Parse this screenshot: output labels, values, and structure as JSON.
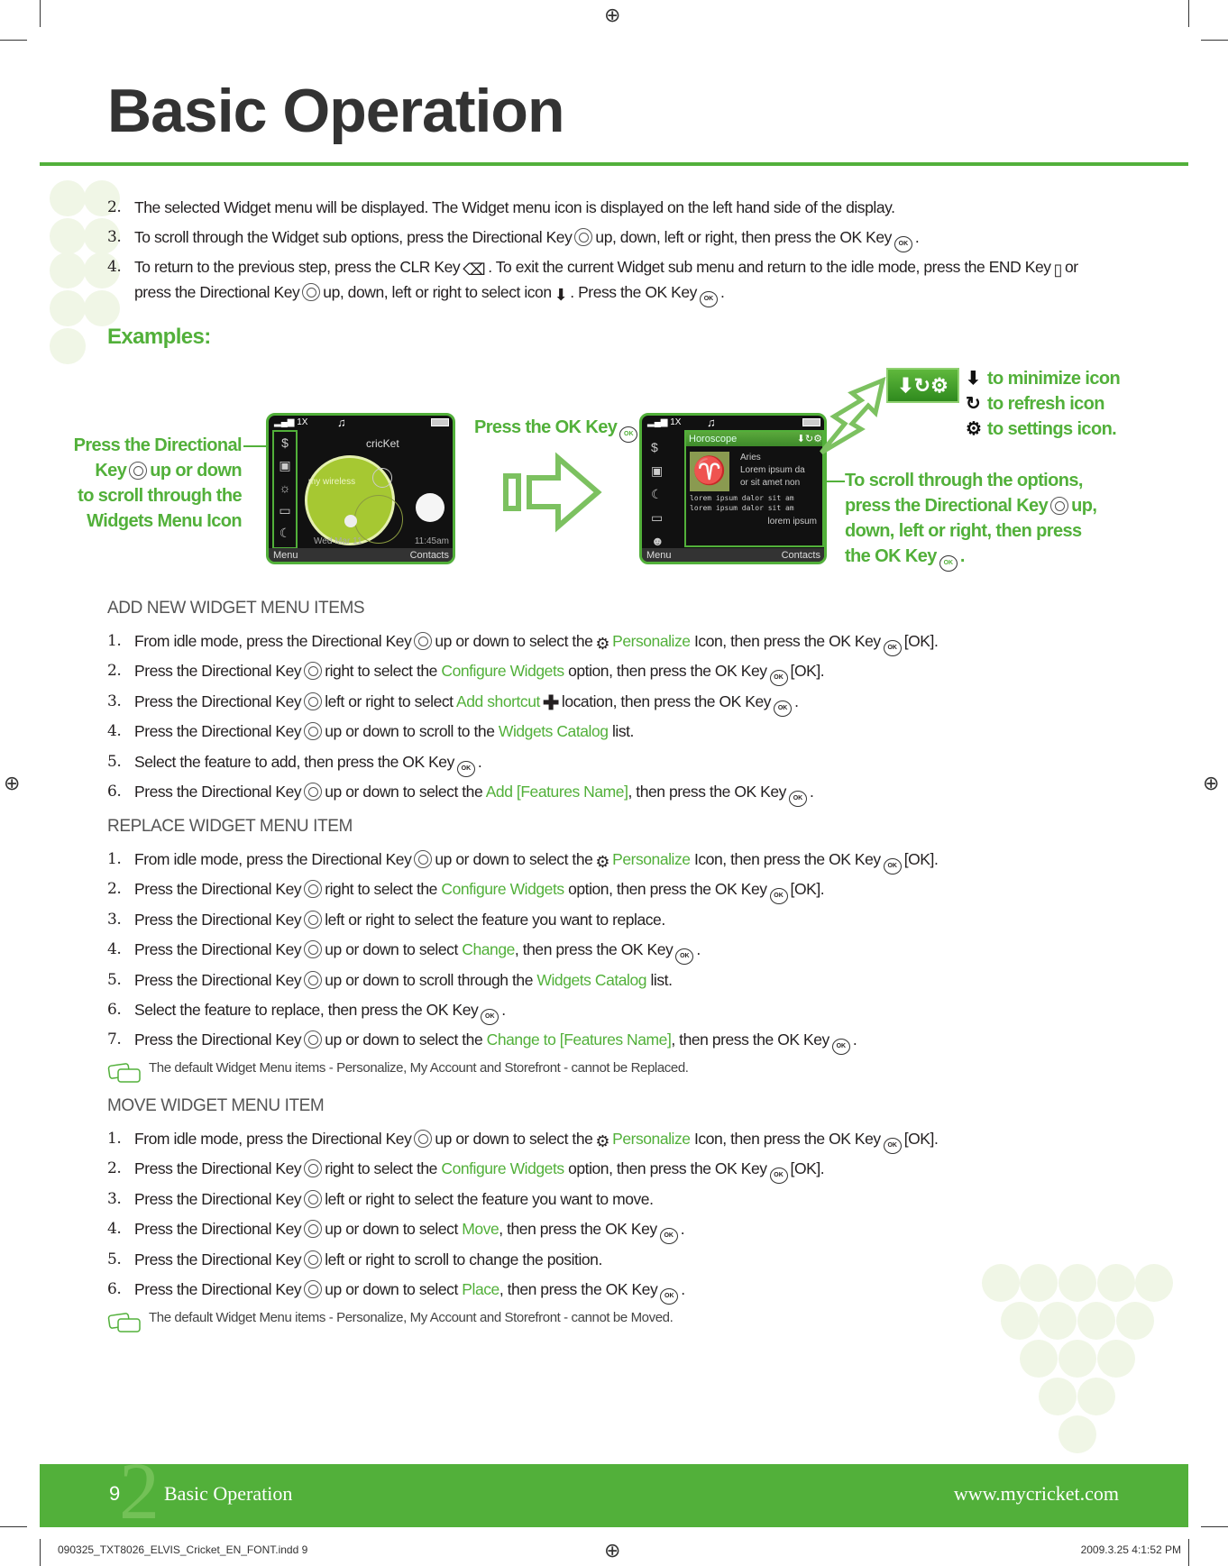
{
  "page_title": "Basic Operation",
  "colors": {
    "accent": "#52b03a",
    "heading": "#555555"
  },
  "intro_steps": [
    {
      "num": "2.",
      "segs": [
        {
          "t": "The selected Widget menu will be displayed. The Widget menu icon is displayed on the left hand side of the display."
        }
      ]
    },
    {
      "num": "3.",
      "segs": [
        {
          "t": "To scroll through the Widget sub options, press the Directional Key"
        },
        {
          "k": "dkey"
        },
        {
          "t": "up, down, left or right, then press the OK Key"
        },
        {
          "k": "ok"
        },
        {
          "t": "."
        }
      ]
    },
    {
      "num": "4.",
      "segs": [
        {
          "t": "To return to the previous step, press the CLR Key"
        },
        {
          "k": "clr"
        },
        {
          "t": ". To exit the current Widget sub menu and return to the idle mode, press the END Key"
        },
        {
          "k": "end"
        },
        {
          "t": "or press the Directional Key"
        },
        {
          "k": "dkey"
        },
        {
          "t": "up, down, left or right to select icon"
        },
        {
          "k": "down-arrow"
        },
        {
          "t": ". Press the OK Key"
        },
        {
          "k": "ok"
        },
        {
          "t": "."
        }
      ]
    }
  ],
  "examples_label": "Examples:",
  "diagram": {
    "left_caption": [
      "Press the Directional",
      "Key",
      "up or down",
      "to scroll through the",
      "Widgets Menu Icon"
    ],
    "ok_caption": "Press the OK Key",
    "right_caption": [
      "To scroll through the options,",
      "press the Directional Key",
      "up,",
      "down, left or right, then press",
      "the OK Key"
    ],
    "legend": [
      "to minimize icon",
      "to refresh icon",
      "to settings icon."
    ],
    "phone1": {
      "brand": "cricKet",
      "bubble": "my wireless",
      "date": "Wed Mar 11",
      "time": "11:45am",
      "soft_left": "Menu",
      "soft_right": "Contacts",
      "network": "1X"
    },
    "phone2": {
      "widget_title": "Horoscope",
      "sign": "Aries",
      "text1": "Lorem ipsum da",
      "text2": "or sit amet non",
      "text3": "lorem ipsum dalor sit am",
      "text4": "lorem ipsum dalor sit am",
      "text5": "lorem ipsum",
      "soft_left": "Menu",
      "soft_right": "Contacts",
      "network": "1X"
    }
  },
  "sections": [
    {
      "heading": "ADD NEW WIDGET MENU ITEMS",
      "steps": [
        {
          "num": "1.",
          "segs": [
            {
              "t": "From idle mode, press the Directional Key"
            },
            {
              "k": "dkey"
            },
            {
              "t": "up or down to select the"
            },
            {
              "k": "personalize"
            },
            {
              "g": "Personalize"
            },
            {
              "t": " Icon, then press the OK Key"
            },
            {
              "k": "ok"
            },
            {
              "t": "[OK]."
            }
          ]
        },
        {
          "num": "2.",
          "segs": [
            {
              "t": "Press the Directional Key"
            },
            {
              "k": "dkey"
            },
            {
              "t": "right to select the "
            },
            {
              "g": "Configure Widgets"
            },
            {
              "t": " option, then press the OK Key"
            },
            {
              "k": "ok"
            },
            {
              "t": "[OK]."
            }
          ]
        },
        {
          "num": "3.",
          "segs": [
            {
              "t": "Press the Directional Key"
            },
            {
              "k": "dkey"
            },
            {
              "t": "left or right to select "
            },
            {
              "g": "Add shortcut"
            },
            {
              "k": "plus"
            },
            {
              "t": "location, then press the OK Key"
            },
            {
              "k": "ok"
            },
            {
              "t": "."
            }
          ]
        },
        {
          "num": "4.",
          "segs": [
            {
              "t": "Press the Directional Key"
            },
            {
              "k": "dkey"
            },
            {
              "t": "up or down to scroll to the "
            },
            {
              "g": "Widgets Catalog"
            },
            {
              "t": " list."
            }
          ]
        },
        {
          "num": "5.",
          "segs": [
            {
              "t": "Select the feature to add, then press the OK Key"
            },
            {
              "k": "ok"
            },
            {
              "t": "."
            }
          ]
        },
        {
          "num": "6.",
          "segs": [
            {
              "t": "Press the Directional Key"
            },
            {
              "k": "dkey"
            },
            {
              "t": "up or down to select the "
            },
            {
              "g": "Add [Features Name]"
            },
            {
              "t": ", then press the OK Key"
            },
            {
              "k": "ok"
            },
            {
              "t": "."
            }
          ]
        }
      ]
    },
    {
      "heading": "REPLACE WIDGET MENU ITEM",
      "steps": [
        {
          "num": "1.",
          "segs": [
            {
              "t": "From idle mode, press the Directional Key"
            },
            {
              "k": "dkey"
            },
            {
              "t": "up or down to select the"
            },
            {
              "k": "personalize"
            },
            {
              "g": "Personalize"
            },
            {
              "t": " Icon, then press the OK Key"
            },
            {
              "k": "ok"
            },
            {
              "t": "[OK]."
            }
          ]
        },
        {
          "num": "2.",
          "segs": [
            {
              "t": "Press the Directional Key"
            },
            {
              "k": "dkey"
            },
            {
              "t": "right to select the "
            },
            {
              "g": "Configure Widgets"
            },
            {
              "t": " option, then press the OK Key"
            },
            {
              "k": "ok"
            },
            {
              "t": "[OK]."
            }
          ]
        },
        {
          "num": "3.",
          "segs": [
            {
              "t": "Press the Directional Key"
            },
            {
              "k": "dkey"
            },
            {
              "t": "left or right to select the feature you want to replace."
            }
          ]
        },
        {
          "num": "4.",
          "segs": [
            {
              "t": "Press the Directional Key"
            },
            {
              "k": "dkey"
            },
            {
              "t": "up or down to select "
            },
            {
              "g": "Change"
            },
            {
              "t": ", then press the OK Key"
            },
            {
              "k": "ok"
            },
            {
              "t": "."
            }
          ]
        },
        {
          "num": "5.",
          "segs": [
            {
              "t": "Press the Directional Key"
            },
            {
              "k": "dkey"
            },
            {
              "t": "up or down to scroll through the "
            },
            {
              "g": "Widgets Catalog"
            },
            {
              "t": " list."
            }
          ]
        },
        {
          "num": "6.",
          "segs": [
            {
              "t": "Select the feature to replace, then press the OK Key"
            },
            {
              "k": "ok"
            },
            {
              "t": "."
            }
          ]
        },
        {
          "num": "7.",
          "segs": [
            {
              "t": "Press the Directional Key"
            },
            {
              "k": "dkey"
            },
            {
              "t": "up or down to select the "
            },
            {
              "g": "Change to [Features Name]"
            },
            {
              "t": ", then press the OK Key"
            },
            {
              "k": "ok"
            },
            {
              "t": "."
            }
          ]
        }
      ],
      "note": "The default Widget Menu items - Personalize, My Account and Storefront - cannot be Replaced."
    },
    {
      "heading": "MOVE WIDGET MENU ITEM",
      "steps": [
        {
          "num": "1.",
          "segs": [
            {
              "t": "From idle mode, press the Directional Key"
            },
            {
              "k": "dkey"
            },
            {
              "t": "up or down to select the"
            },
            {
              "k": "personalize"
            },
            {
              "g": "Personalize"
            },
            {
              "t": " Icon, then press the OK Key"
            },
            {
              "k": "ok"
            },
            {
              "t": "[OK]."
            }
          ]
        },
        {
          "num": "2.",
          "segs": [
            {
              "t": "Press the Directional Key"
            },
            {
              "k": "dkey"
            },
            {
              "t": "right to select the "
            },
            {
              "g": "Configure Widgets"
            },
            {
              "t": " option, then press the OK Key"
            },
            {
              "k": "ok"
            },
            {
              "t": "[OK]."
            }
          ]
        },
        {
          "num": "3.",
          "segs": [
            {
              "t": "Press the Directional Key"
            },
            {
              "k": "dkey"
            },
            {
              "t": "left or right to select the feature you want to move."
            }
          ]
        },
        {
          "num": "4.",
          "segs": [
            {
              "t": "Press the Directional Key"
            },
            {
              "k": "dkey"
            },
            {
              "t": "up or down to select "
            },
            {
              "g": "Move"
            },
            {
              "t": ", then press the OK Key"
            },
            {
              "k": "ok"
            },
            {
              "t": "."
            }
          ]
        },
        {
          "num": "5.",
          "segs": [
            {
              "t": "Press the Directional Key"
            },
            {
              "k": "dkey"
            },
            {
              "t": "left or right to scroll to change the position."
            }
          ]
        },
        {
          "num": "6.",
          "segs": [
            {
              "t": "Press the Directional Key"
            },
            {
              "k": "dkey"
            },
            {
              "t": "up or down to select "
            },
            {
              "g": "Place"
            },
            {
              "t": ", then press the OK Key"
            },
            {
              "k": "ok"
            },
            {
              "t": "."
            }
          ]
        }
      ],
      "note": "The default Widget Menu items - Personalize, My Account and Storefront - cannot be Moved."
    }
  ],
  "footer": {
    "page_number": "9",
    "chapter_number": "2",
    "chapter": "Basic Operation",
    "url": "www.mycricket.com"
  },
  "print_meta": {
    "file": "090325_TXT8026_ELVIS_Cricket_EN_FONT.indd   9",
    "timestamp": "2009.3.25   4:1:52 PM"
  }
}
